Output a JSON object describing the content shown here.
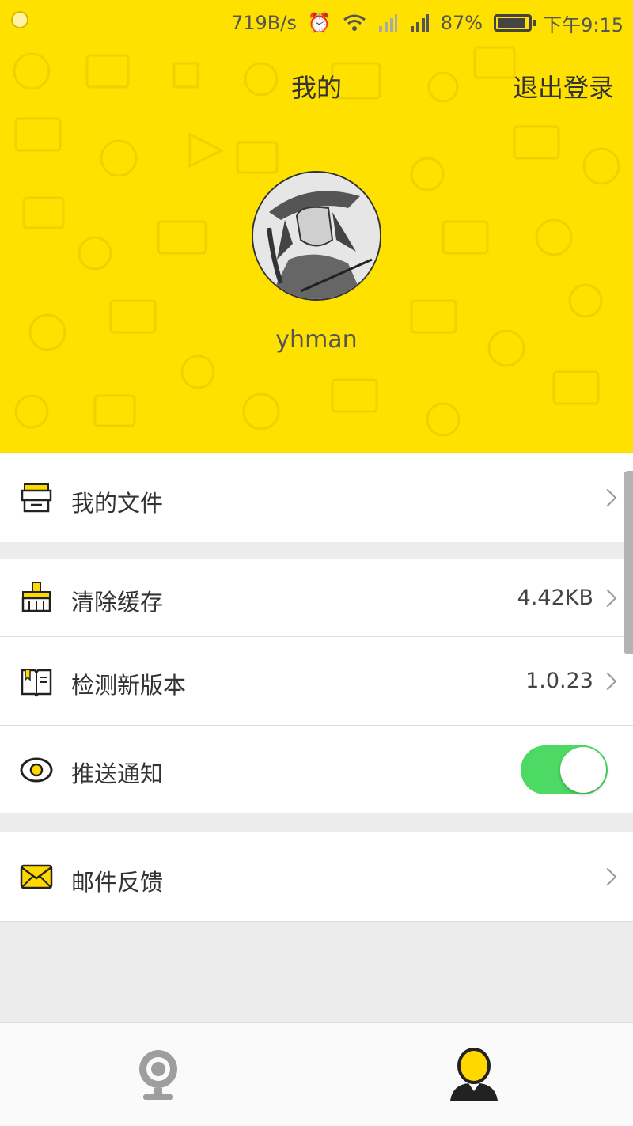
{
  "status_bar": {
    "net_speed": "719B/s",
    "battery": "87%",
    "time": "下午9:15",
    "icons": [
      "app-notification-icon",
      "alarm-icon",
      "wifi-icon",
      "signal-icon",
      "battery-icon"
    ]
  },
  "nav": {
    "title": "我的",
    "logout": "退出登录"
  },
  "profile": {
    "username": "yhman"
  },
  "menu": {
    "files": {
      "label": "我的文件",
      "icon": "folder-tray-icon"
    },
    "cache": {
      "label": "清除缓存",
      "value": "4.42KB",
      "icon": "broom-icon"
    },
    "version": {
      "label": "检测新版本",
      "value": "1.0.23",
      "icon": "book-icon"
    },
    "push": {
      "label": "推送通知",
      "enabled": true,
      "icon": "eye-icon"
    },
    "feedback": {
      "label": "邮件反馈",
      "icon": "mail-icon"
    }
  },
  "tabs": [
    {
      "icon": "camera-icon",
      "active": false
    },
    {
      "icon": "user-icon",
      "active": true
    }
  ],
  "colors": {
    "header": "#ffe100",
    "accent": "#ffd800",
    "toggle_on": "#4cd964"
  }
}
